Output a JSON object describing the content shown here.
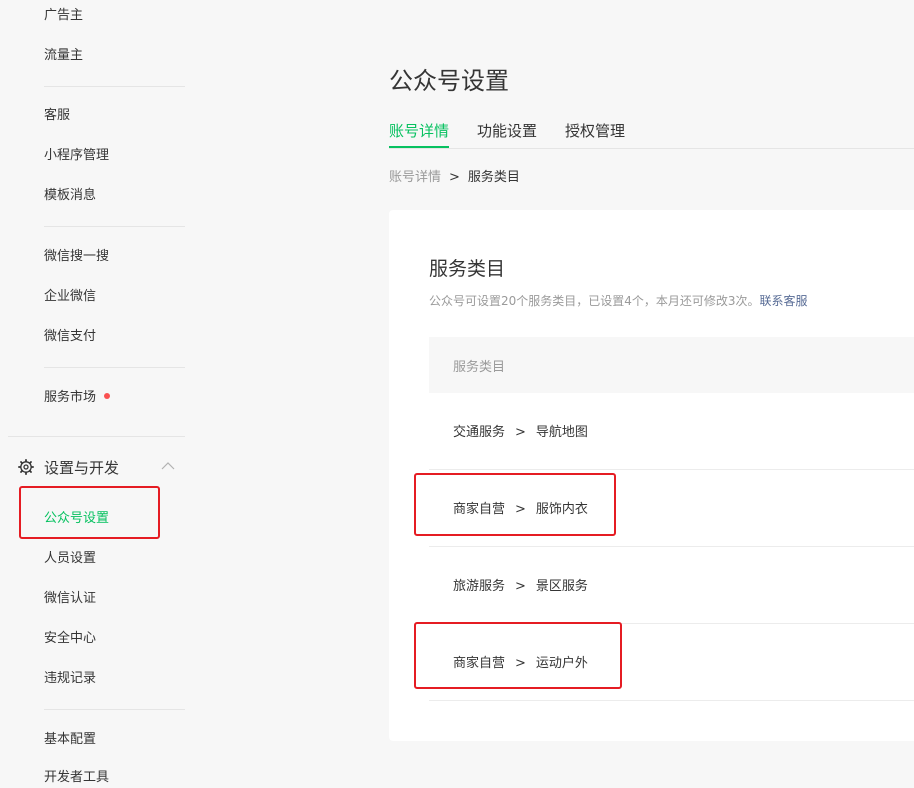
{
  "sidebar": {
    "items_top": [
      "广告主",
      "流量主"
    ],
    "items_group2": [
      "客服",
      "小程序管理",
      "模板消息"
    ],
    "items_group3": [
      "微信搜一搜",
      "企业微信",
      "微信支付"
    ],
    "market": "服务市场",
    "section_title": "设置与开发",
    "section_items": [
      "公众号设置",
      "人员设置",
      "微信认证",
      "安全中心",
      "违规记录"
    ],
    "items_bottom": [
      "基本配置",
      "开发者工具"
    ]
  },
  "main": {
    "title": "公众号设置",
    "tabs": [
      "账号详情",
      "功能设置",
      "授权管理"
    ],
    "active_tab": "账号详情",
    "breadcrumb": {
      "parent": "账号详情",
      "separator": ">",
      "current": "服务类目"
    }
  },
  "card": {
    "title": "服务类目",
    "desc": "公众号可设置20个服务类目，已设置4个，本月还可修改3次。",
    "desc_link": "联系客服",
    "table_header": "服务类目",
    "rows": [
      {
        "primary": "交通服务",
        "sep": ">",
        "secondary": "导航地图"
      },
      {
        "primary": "商家自营",
        "sep": ">",
        "secondary": "服饰内衣"
      },
      {
        "primary": "旅游服务",
        "sep": ">",
        "secondary": "景区服务"
      },
      {
        "primary": "商家自营",
        "sep": ">",
        "secondary": "运动户外"
      }
    ]
  },
  "colors": {
    "accent": "#07c160",
    "link": "#576b95",
    "highlight": "#e51c23",
    "badge": "#fa5151"
  },
  "icons": {
    "settings": "gear-icon",
    "collapse": "chevron-up-icon"
  }
}
